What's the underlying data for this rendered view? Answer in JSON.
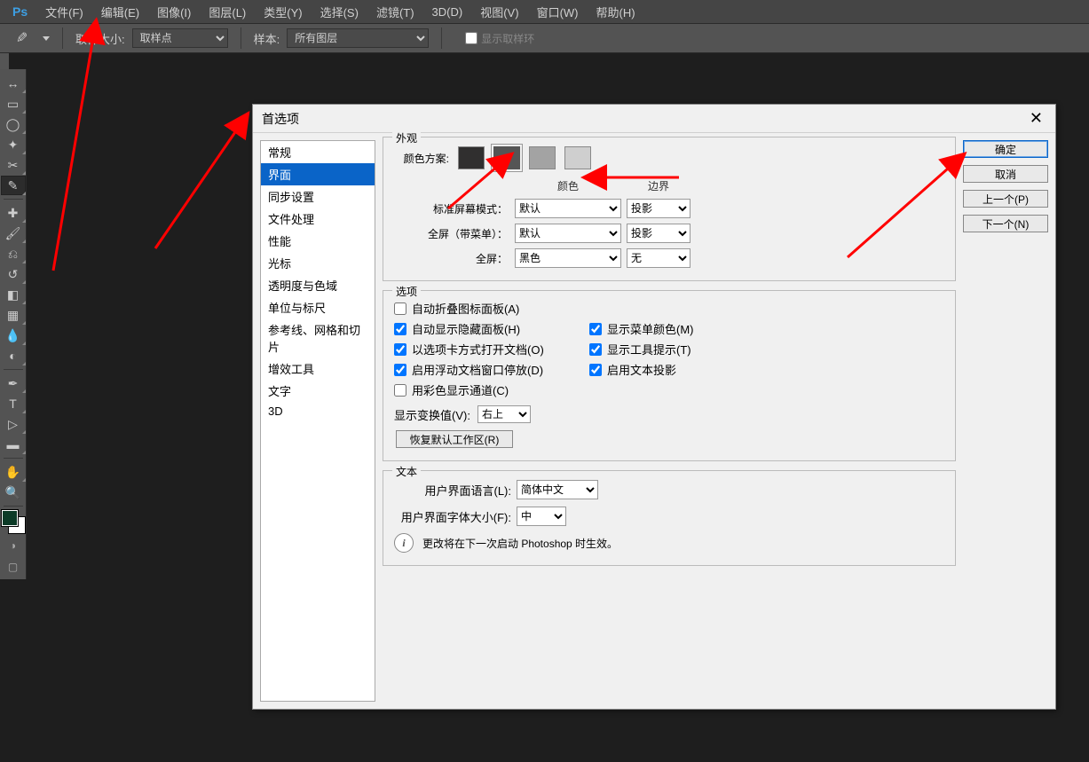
{
  "app": {
    "logo": "Ps"
  },
  "menu": [
    "文件(F)",
    "编辑(E)",
    "图像(I)",
    "图层(L)",
    "类型(Y)",
    "选择(S)",
    "滤镜(T)",
    "3D(D)",
    "视图(V)",
    "窗口(W)",
    "帮助(H)"
  ],
  "optionsbar": {
    "sample_size_label": "取样大小:",
    "sample_size_value": "取样点",
    "sample_label": "样本:",
    "sample_value": "所有图层",
    "show_ring": "显示取样环"
  },
  "tools": [
    "move",
    "marquee",
    "lasso",
    "wand",
    "crop",
    "eyedropper",
    "healing",
    "brush",
    "stamp",
    "history",
    "eraser",
    "gradient",
    "blur",
    "dodge",
    "pen",
    "type",
    "path-select",
    "rectangle",
    "hand",
    "zoom"
  ],
  "dialog": {
    "title": "首选项",
    "close": "✕",
    "categories": [
      "常规",
      "界面",
      "同步设置",
      "文件处理",
      "性能",
      "光标",
      "透明度与色域",
      "单位与标尺",
      "参考线、网格和切片",
      "增效工具",
      "文字",
      "3D"
    ],
    "selected_index": 1,
    "buttons": {
      "ok": "确定",
      "cancel": "取消",
      "prev": "上一个(P)",
      "next": "下一个(N)"
    },
    "appearance": {
      "legend": "外观",
      "color_scheme_label": "颜色方案:",
      "swatches": [
        "#302f2f",
        "#555555",
        "#a3a3a3",
        "#cfcfcf"
      ],
      "selected_swatch": 1,
      "head_color": "颜色",
      "head_border": "边界",
      "rows": [
        {
          "label": "标准屏幕模式：",
          "color": "默认",
          "border": "投影"
        },
        {
          "label": "全屏（带菜单）：",
          "color": "默认",
          "border": "投影"
        },
        {
          "label": "全屏：",
          "color": "黑色",
          "border": "无"
        }
      ]
    },
    "options": {
      "legend": "选项",
      "checks": [
        {
          "label": "自动折叠图标面板(A)",
          "checked": false
        },
        {
          "label": "自动显示隐藏面板(H)",
          "checked": true
        },
        {
          "label": "显示菜单颜色(M)",
          "checked": true
        },
        {
          "label": "以选项卡方式打开文档(O)",
          "checked": true
        },
        {
          "label": "显示工具提示(T)",
          "checked": true
        },
        {
          "label": "启用浮动文档窗口停放(D)",
          "checked": true
        },
        {
          "label": "启用文本投影",
          "checked": true
        },
        {
          "label": "用彩色显示通道(C)",
          "checked": false
        }
      ],
      "transform_label": "显示变换值(V):",
      "transform_value": "右上",
      "reset_btn": "恢复默认工作区(R)"
    },
    "text": {
      "legend": "文本",
      "lang_label": "用户界面语言(L):",
      "lang_value": "简体中文",
      "font_label": "用户界面字体大小(F):",
      "font_value": "中",
      "info": "更改将在下一次启动 Photoshop 时生效。"
    }
  }
}
